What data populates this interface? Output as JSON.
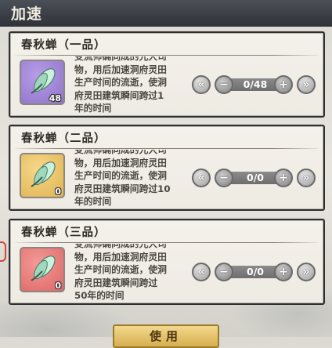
{
  "header": {
    "title": "加速"
  },
  "cards": [
    {
      "name": "春秋蝉（一品）",
      "icon": "cicada-icon",
      "icon_color": "#9e83d8",
      "count": "48",
      "desc_lines": [
        "变流师确同成的光大司",
        "物，用后加速洞府灵田",
        "生产时间的流逝，使洞",
        "府灵田建筑瞬间跨过1",
        "年的时间"
      ],
      "quantity": "0/48"
    },
    {
      "name": "春秋蝉（二品）",
      "icon": "cicada-icon",
      "icon_color": "#ecc46a",
      "count": "0",
      "desc_lines": [
        "变流师确同成的光大司",
        "物，用后加速洞府灵田",
        "生产时间的流逝，使洞",
        "府灵田建筑瞬间跨过10",
        "年的时间"
      ],
      "quantity": "0/0"
    },
    {
      "name": "春秋蝉（三品）",
      "icon": "cicada-icon",
      "icon_color": "#e87f7d",
      "count": "0",
      "desc_lines": [
        "变流师确同成的光大司",
        "物，用后加速洞府灵田",
        "生产时间的流逝，使洞",
        "府灵田建筑瞬间跨过",
        "50年的时间"
      ],
      "quantity": "0/0"
    }
  ],
  "controls": {
    "first_icon": "double-chevron-left-icon",
    "minus_icon": "minus-icon",
    "plus_icon": "plus-icon",
    "last_icon": "double-chevron-right-icon"
  },
  "confirm": {
    "label": "使用"
  }
}
